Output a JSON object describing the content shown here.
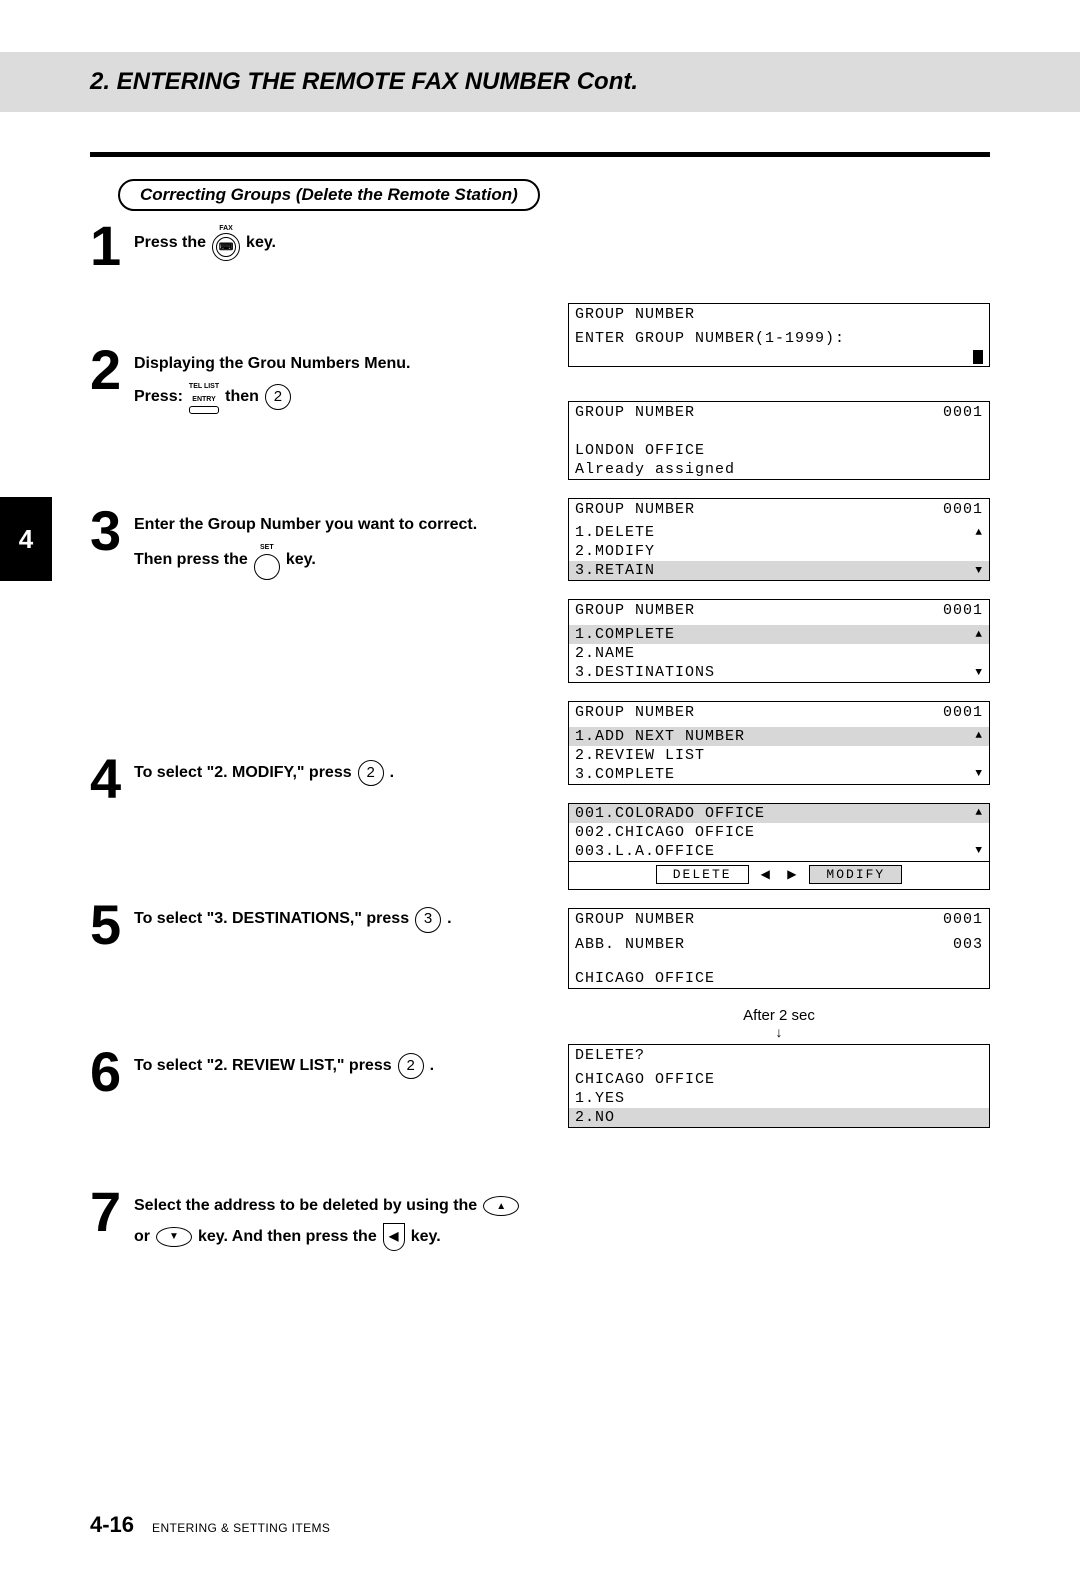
{
  "header": {
    "title": "2. ENTERING THE REMOTE FAX NUMBER Cont."
  },
  "side_tab": "4",
  "subheading": "Correcting Groups (Delete the Remote Station)",
  "steps": [
    {
      "num": "1",
      "lines": [
        [
          {
            "t": "Press the"
          },
          {
            "icon": "fax-key"
          },
          {
            "t": "key."
          }
        ]
      ]
    },
    {
      "num": "2",
      "lines": [
        [
          {
            "t": "Displaying the Grou Numbers Menu."
          }
        ],
        [
          {
            "t": "Press:"
          },
          {
            "icon": "tel-list-entry"
          },
          {
            "t": "then"
          },
          {
            "icon": "num",
            "v": "2"
          }
        ]
      ]
    },
    {
      "num": "3",
      "lines": [
        [
          {
            "t": "Enter the Group Number you want to correct."
          }
        ],
        [
          {
            "t": "Then press the"
          },
          {
            "icon": "set-key"
          },
          {
            "t": "key."
          }
        ]
      ]
    },
    {
      "num": "4",
      "lines": [
        [
          {
            "t": "To select \"2. MODIFY,\" press"
          },
          {
            "icon": "num",
            "v": "2"
          },
          {
            "t": "."
          }
        ]
      ]
    },
    {
      "num": "5",
      "lines": [
        [
          {
            "t": "To select \"3. DESTINATIONS,\" press"
          },
          {
            "icon": "num",
            "v": "3"
          },
          {
            "t": "."
          }
        ]
      ]
    },
    {
      "num": "6",
      "lines": [
        [
          {
            "t": "To select \"2. REVIEW LIST,\" press"
          },
          {
            "icon": "num",
            "v": "2"
          },
          {
            "t": "."
          }
        ]
      ]
    },
    {
      "num": "7",
      "lines": [
        [
          {
            "t": "Select the address to be deleted by using the"
          },
          {
            "icon": "oval-up"
          }
        ],
        [
          {
            "t": "or"
          },
          {
            "icon": "oval-down"
          },
          {
            "t": "key. And then press the"
          },
          {
            "icon": "shield-left"
          },
          {
            "t": "key."
          }
        ]
      ]
    }
  ],
  "lcds": {
    "s2": {
      "title": "GROUP NUMBER",
      "body": "ENTER GROUP NUMBER(1-1999):"
    },
    "s3a": {
      "title": "GROUP NUMBER",
      "code": "0001",
      "l1": "LONDON OFFICE",
      "l2": "Already assigned"
    },
    "s3b": {
      "title": "GROUP NUMBER",
      "code": "0001",
      "rows": [
        {
          "t": "1.DELETE",
          "arrow": "up"
        },
        {
          "t": "2.MODIFY"
        },
        {
          "t": "3.RETAIN",
          "arrow": "down",
          "shade": true
        }
      ]
    },
    "s4": {
      "title": "GROUP NUMBER",
      "code": "0001",
      "rows": [
        {
          "t": "1.COMPLETE",
          "arrow": "up",
          "shade": true
        },
        {
          "t": "2.NAME"
        },
        {
          "t": "3.DESTINATIONS",
          "arrow": "down"
        }
      ]
    },
    "s5": {
      "title": "GROUP NUMBER",
      "code": "0001",
      "rows": [
        {
          "t": "1.ADD NEXT NUMBER",
          "arrow": "up",
          "shade": true
        },
        {
          "t": "2.REVIEW LIST"
        },
        {
          "t": "3.COMPLETE",
          "arrow": "down"
        }
      ]
    },
    "s6": {
      "rows": [
        {
          "t": "001.COLORADO OFFICE",
          "arrow": "up",
          "shade": true
        },
        {
          "t": "002.CHICAGO OFFICE"
        },
        {
          "t": "003.L.A.OFFICE",
          "arrow": "down"
        }
      ],
      "btns": {
        "left": "DELETE",
        "right": "MODIFY"
      }
    },
    "s7a": {
      "title": "GROUP NUMBER",
      "code": "0001",
      "sub": "ABB. NUMBER",
      "subcode": "003",
      "l1": "CHICAGO OFFICE"
    },
    "transition": "After 2 sec",
    "s7b": {
      "title": "DELETE?",
      "l0": "CHICAGO OFFICE",
      "rows": [
        {
          "t": "1.YES"
        },
        {
          "t": "2.NO",
          "shade": true
        }
      ]
    }
  },
  "footer": {
    "page": "4-16",
    "section": "ENTERING & SETTING ITEMS"
  },
  "dashes": "__ __ __ __ __ __"
}
